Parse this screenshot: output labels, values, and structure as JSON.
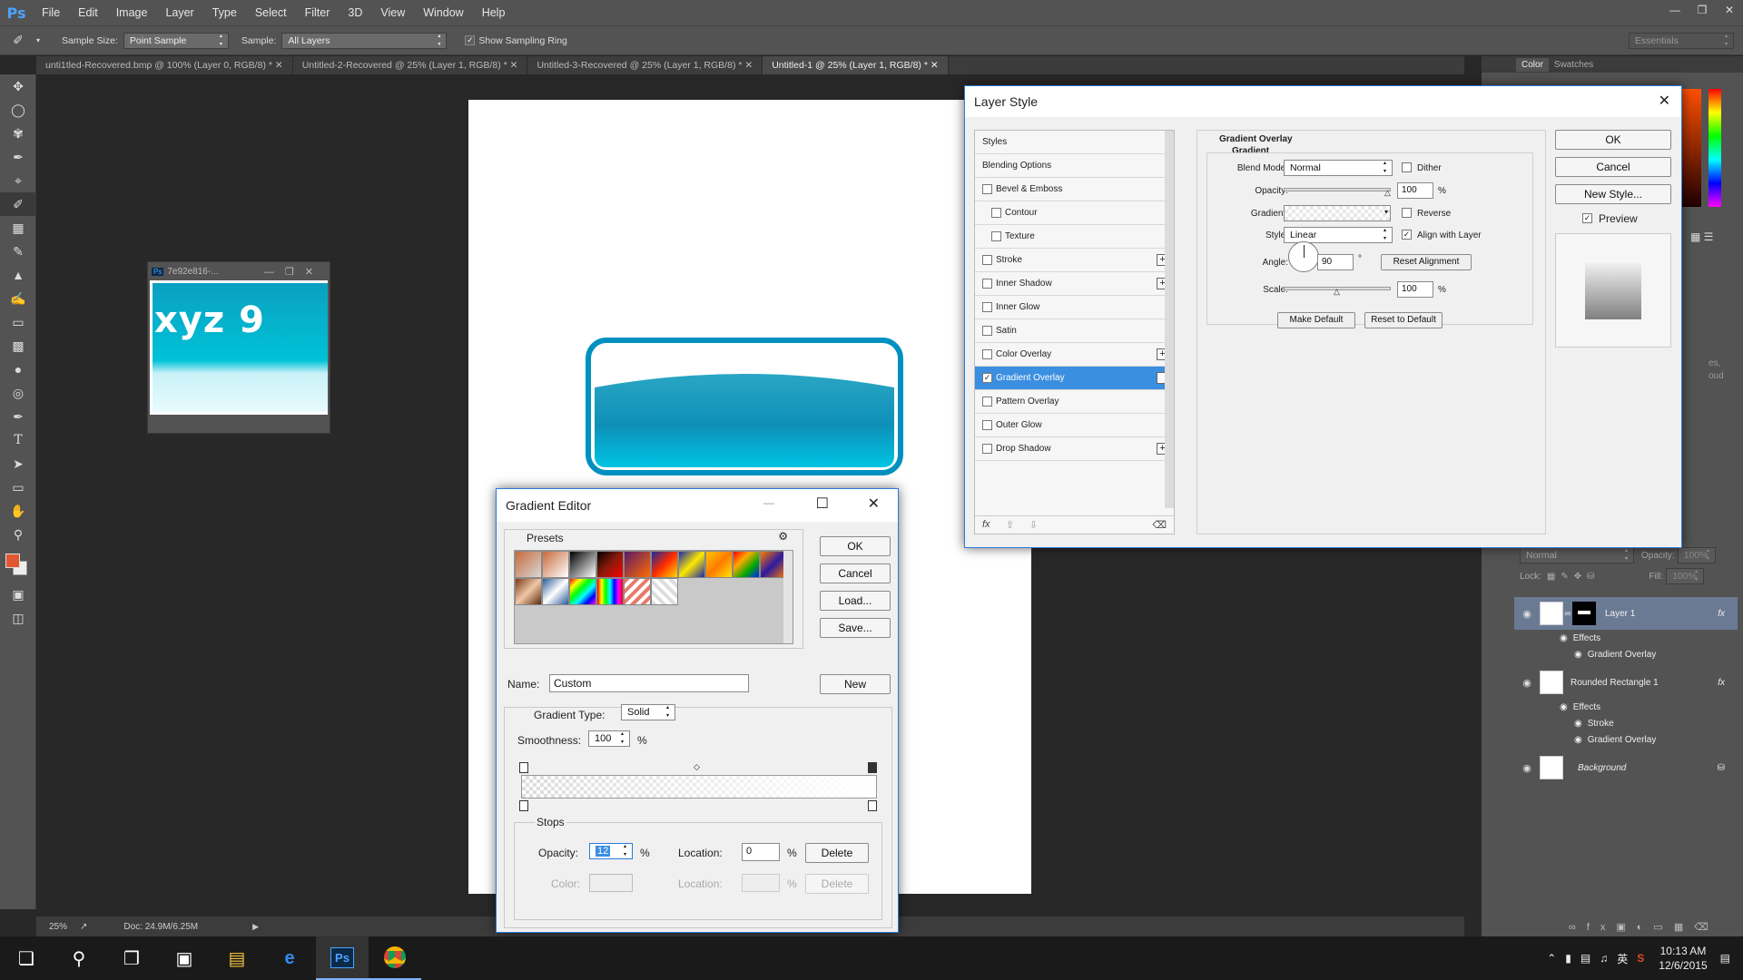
{
  "app": {
    "logo": "Ps",
    "menu": [
      "File",
      "Edit",
      "Image",
      "Layer",
      "Type",
      "Select",
      "Filter",
      "3D",
      "View",
      "Window",
      "Help"
    ],
    "workspace": "Essentials"
  },
  "options": {
    "sample_size_label": "Sample Size:",
    "sample_size_value": "Point Sample",
    "sample_label": "Sample:",
    "sample_value": "All Layers",
    "sampling_ring": "Show Sampling Ring"
  },
  "tabs": [
    {
      "label": "unti1tled-Recovered.bmp @ 100% (Layer 0, RGB/8) *"
    },
    {
      "label": "Untitled-2-Recovered @ 25% (Layer 1, RGB/8) *"
    },
    {
      "label": "Untitled-3-Recovered @ 25% (Layer 1, RGB/8) *"
    },
    {
      "label": "Untitled-1 @ 25% (Layer 1, RGB/8) *"
    }
  ],
  "float_window": {
    "title": "7e92e816-...",
    "image_text": "xyz 9"
  },
  "status": {
    "zoom": "25%",
    "doc": "Doc: 24.9M/6.25M"
  },
  "layer_style": {
    "title": "Layer Style",
    "styles_header": "Styles",
    "blending": "Blending Options",
    "items": [
      {
        "label": "Bevel & Emboss",
        "checked": false,
        "plus": false
      },
      {
        "label": "Contour",
        "checked": false,
        "plus": false
      },
      {
        "label": "Texture",
        "checked": false,
        "plus": false
      },
      {
        "label": "Stroke",
        "checked": false,
        "plus": true
      },
      {
        "label": "Inner Shadow",
        "checked": false,
        "plus": true
      },
      {
        "label": "Inner Glow",
        "checked": false,
        "plus": false
      },
      {
        "label": "Satin",
        "checked": false,
        "plus": false
      },
      {
        "label": "Color Overlay",
        "checked": false,
        "plus": true
      },
      {
        "label": "Gradient Overlay",
        "checked": true,
        "plus": true
      },
      {
        "label": "Pattern Overlay",
        "checked": false,
        "plus": false
      },
      {
        "label": "Outer Glow",
        "checked": false,
        "plus": false
      },
      {
        "label": "Drop Shadow",
        "checked": false,
        "plus": true
      }
    ],
    "section_title": "Gradient Overlay",
    "section_sub": "Gradient",
    "blend_mode_label": "Blend Mode:",
    "blend_mode": "Normal",
    "dither": "Dither",
    "opacity_label": "Opacity:",
    "opacity": "100",
    "pct": "%",
    "gradient_label": "Gradient:",
    "reverse": "Reverse",
    "style_label": "Style:",
    "style": "Linear",
    "align": "Align with Layer",
    "angle_label": "Angle:",
    "angle": "90",
    "deg": "°",
    "reset_alignment": "Reset Alignment",
    "scale_label": "Scale:",
    "scale": "100",
    "make_default": "Make Default",
    "reset_default": "Reset to Default",
    "ok": "OK",
    "cancel": "Cancel",
    "new_style": "New Style...",
    "preview": "Preview"
  },
  "gradient_editor": {
    "title": "Gradient Editor",
    "presets": "Presets",
    "ok": "OK",
    "cancel": "Cancel",
    "load": "Load...",
    "save": "Save...",
    "name_label": "Name:",
    "name": "Custom",
    "new": "New",
    "type_label": "Gradient Type:",
    "type": "Solid",
    "smooth_label": "Smoothness:",
    "smooth": "100",
    "pct": "%",
    "stops": "Stops",
    "opacity_label": "Opacity:",
    "opacity": "12",
    "location_label": "Location:",
    "location": "0",
    "delete": "Delete",
    "color_label": "Color:",
    "location2_label": "Location:"
  },
  "layers": {
    "mode": "Normal",
    "opacity_label": "Opacity:",
    "opacity": "100%",
    "lock_label": "Lock:",
    "fill_label": "Fill:",
    "fill": "100%",
    "effects": "Effects",
    "list": [
      {
        "name": "Layer 1",
        "fx": [
          "Gradient Overlay"
        ]
      },
      {
        "name": "Rounded Rectangle 1",
        "fx": [
          "Stroke",
          "Gradient Overlay"
        ]
      },
      {
        "name": "Background",
        "fx": []
      }
    ]
  },
  "right_tabs": {
    "color": "Color",
    "swatches": "Swatches"
  },
  "right_partial": [
    "es,",
    "oud"
  ],
  "clock": {
    "time": "10:13 AM",
    "date": "12/6/2015",
    "ime": "英"
  }
}
